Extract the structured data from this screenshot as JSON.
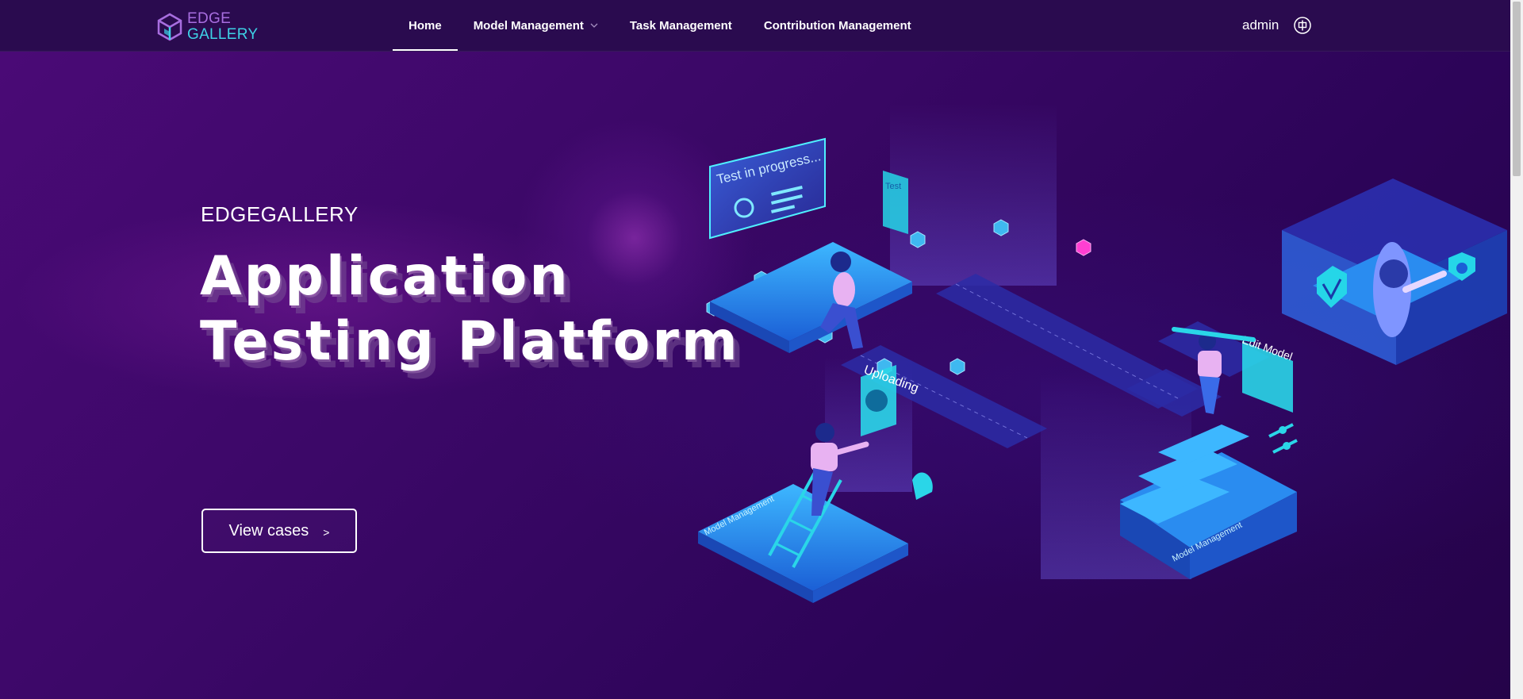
{
  "logo": {
    "line1": "EDGE",
    "line2": "GALLERY"
  },
  "nav": {
    "items": [
      {
        "label": "Home",
        "active": true
      },
      {
        "label": "Model Management",
        "dropdown": true
      },
      {
        "label": "Task Management"
      },
      {
        "label": "Contribution Management"
      }
    ]
  },
  "user": {
    "name": "admin",
    "language_icon": "language-toggle-icon"
  },
  "hero": {
    "subtitle": "EDGEGALLERY",
    "title_line1": "Application",
    "title_line2": "Testing Platform",
    "cta_label": "View cases",
    "cta_arrow": ">"
  },
  "illustration": {
    "screen_text": "Test in progress...",
    "phone_text": "Test",
    "uploading_text": "Uploading",
    "edit_text": "Edit Model",
    "platform_label_1": "Model Management",
    "platform_label_2": "Model Management"
  },
  "colors": {
    "header_bg": "#2a0b4f",
    "page_bg": "#3c0868",
    "accent_cyan": "#3ed2e6",
    "logo_purple": "#a86ee0"
  }
}
